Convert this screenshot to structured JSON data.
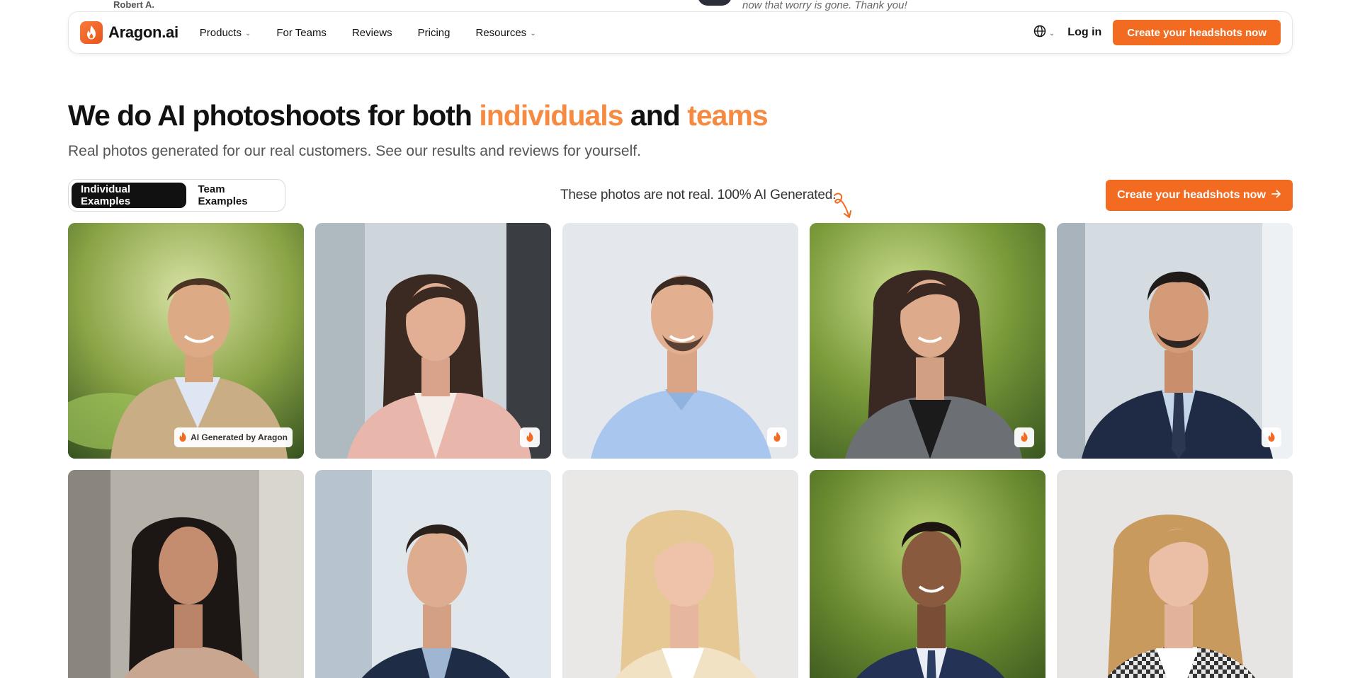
{
  "background_testimonial": {
    "author": "Robert A.",
    "quote": "now that worry is gone. Thank you!"
  },
  "nav": {
    "logo_text": "Aragon.ai",
    "items": [
      {
        "label": "Products",
        "dropdown": true
      },
      {
        "label": "For Teams",
        "dropdown": false
      },
      {
        "label": "Reviews",
        "dropdown": false
      },
      {
        "label": "Pricing",
        "dropdown": false
      },
      {
        "label": "Resources",
        "dropdown": true
      }
    ],
    "language_icon": "globe-icon",
    "login_label": "Log in",
    "cta_label": "Create your headshots now"
  },
  "hero": {
    "title_part1": "We do AI photoshoots for both ",
    "title_accent1": "individuals",
    "title_part2": " and ",
    "title_accent2": "teams",
    "subtitle": "Real photos generated for our real customers. See our results and reviews for yourself."
  },
  "controls": {
    "tabs": [
      {
        "label": "Individual Examples",
        "active": true
      },
      {
        "label": "Team Examples",
        "active": false
      }
    ],
    "disclaimer": "These photos are not real. 100% AI Generated.",
    "cta_label": "Create your headshots now"
  },
  "gallery": {
    "badge_text": "AI Generated by Aragon",
    "photos": [
      {
        "name": "photo-man-beige-blazer-park"
      },
      {
        "name": "photo-woman-pink-blazer-office"
      },
      {
        "name": "photo-man-blue-shirt-studio"
      },
      {
        "name": "photo-woman-plaid-blazer-park"
      },
      {
        "name": "photo-man-navy-suit-building"
      },
      {
        "name": "photo-woman-tan-sweater-hallway"
      },
      {
        "name": "photo-man-navy-blazer-office"
      },
      {
        "name": "photo-woman-cream-blazer-studio"
      },
      {
        "name": "photo-man-navy-suit-park"
      },
      {
        "name": "photo-woman-houndstooth-studio"
      }
    ]
  },
  "colors": {
    "accent": "#f26b21",
    "accent_text": "#f58a40"
  }
}
